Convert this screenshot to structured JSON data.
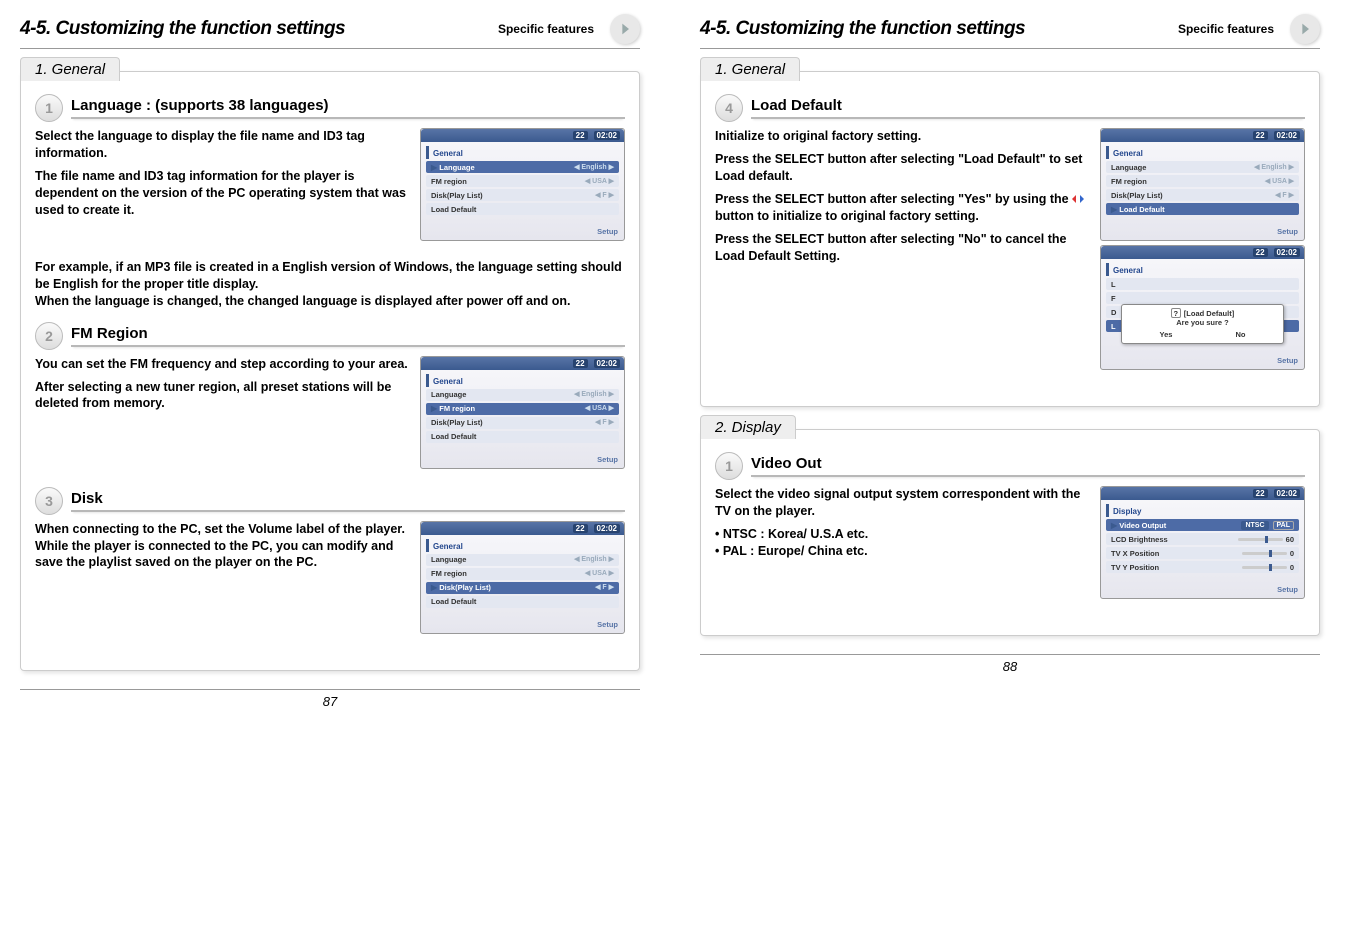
{
  "header": {
    "section": "4-5. Customizing the function settings",
    "tag": "Specific features"
  },
  "left": {
    "tab": "1. General",
    "item1": {
      "title": "Language : (supports 38 languages)",
      "textA": "Select the language to display the file name and ID3 tag information.",
      "textB": "The file name and ID3 tag information for the player is dependent on the version of the PC operating system that was used to create it.",
      "extra": "For example, if an MP3 file is created in a English version of Windows, the language setting should be English for the proper title display.\nWhen the language is changed, the changed language is displayed after power off and on."
    },
    "item2": {
      "title": "FM Region",
      "textA": "You can set the FM frequency and step according to your area.",
      "textB": "After selecting a new tuner region, all preset stations will be deleted from memory."
    },
    "item3": {
      "title": "Disk",
      "textA": "When connecting to the PC, set the Volume label of the player.\nWhile the player is connected to the PC, you can modify and save the playlist saved on the player on the PC."
    },
    "pageNum": "87"
  },
  "right": {
    "tab1": "1. General",
    "item4": {
      "title": "Load Default",
      "textA": "Initialize to original factory setting.",
      "lineB": "Press the SELECT button after selecting  \"Load Default\" to set Load default.",
      "lineC_a": "Press the SELECT button after selecting  \"Yes\" by using the ",
      "lineC_b": " button to initialize to original factory setting.",
      "lineD": "Press the SELECT button after selecting  \"No\" to cancel the Load Default Setting."
    },
    "tab2": "2. Display",
    "item5": {
      "title": "Video Out",
      "textA": "Select the video signal output system correspondent with the TV on the player.",
      "bullet1": "NTSC : Korea/ U.S.A etc.",
      "bullet2": "PAL : Europe/ China etc."
    },
    "pageNum": "88"
  },
  "lcd": {
    "badge1": "22",
    "badge2": "02:02",
    "menuGeneral": "General",
    "menuDisplay": "Display",
    "lang": "Language",
    "langV": "English",
    "fm": "FM region",
    "fmV": "USA",
    "disk": "Disk(Play List)",
    "diskV": "F",
    "load": "Load Default",
    "footer": "Setup",
    "popupTitle": "[Load Default]",
    "popupQ": "Are you sure ?",
    "yes": "Yes",
    "no": "No",
    "vout": "Video Output",
    "ntsc": "NTSC",
    "pal": "PAL",
    "lcdb": "LCD Brightness",
    "lcdbV": "60",
    "tvx": "TV X Position",
    "tvxV": "0",
    "tvy": "TV Y Position",
    "tvyV": "0"
  }
}
